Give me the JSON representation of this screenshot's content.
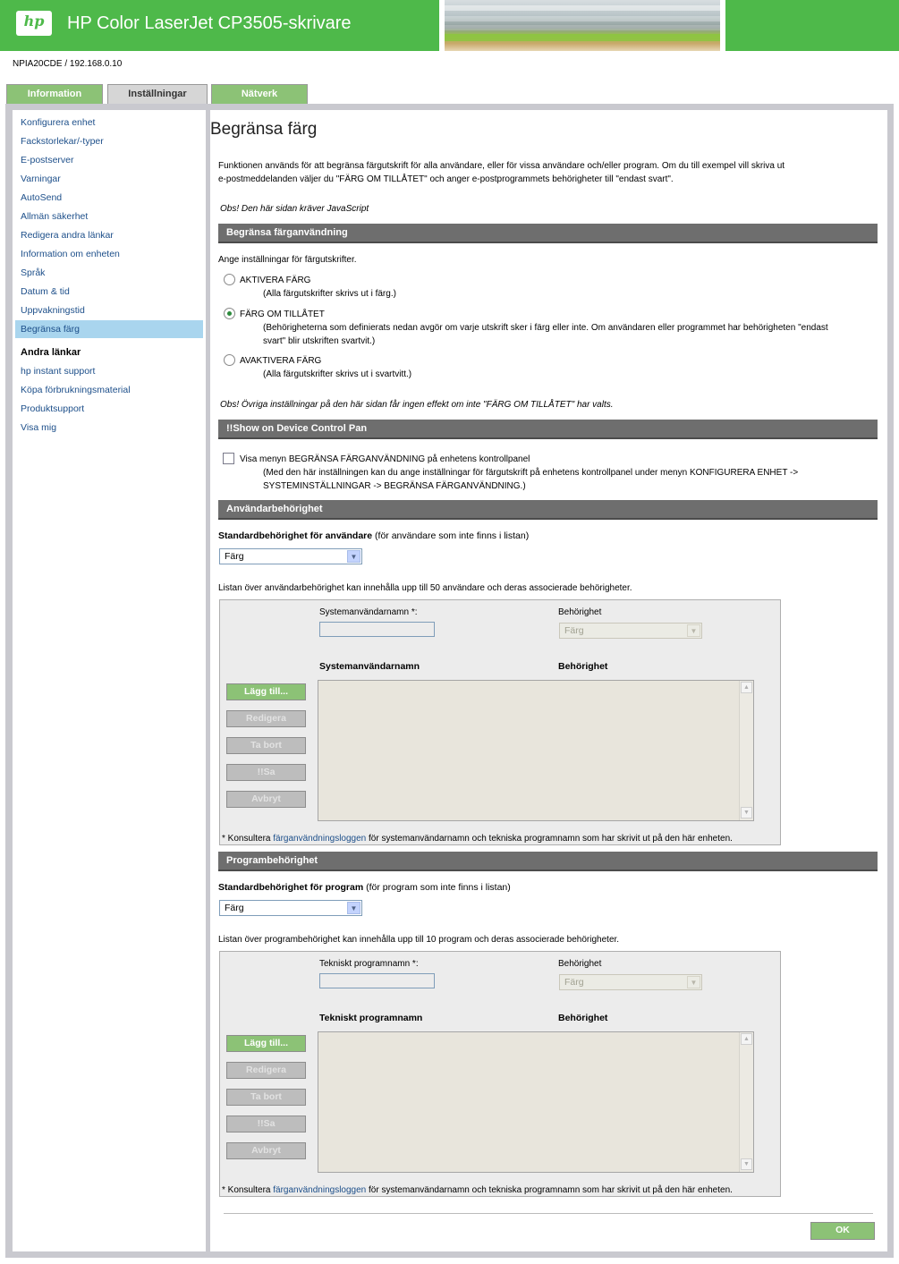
{
  "header": {
    "logo_text": "hp",
    "title": "HP Color LaserJet CP3505-skrivare",
    "device_id": "NPIA20CDE / 192.168.0.10"
  },
  "tabs": [
    {
      "label": "Information",
      "active": false
    },
    {
      "label": "Inställningar",
      "active": true
    },
    {
      "label": "Nätverk",
      "active": false
    }
  ],
  "sidebar": {
    "items": [
      "Konfigurera enhet",
      "Fackstorlekar/-typer",
      "E-postserver",
      "Varningar",
      "AutoSend",
      "Allmän säkerhet",
      "Redigera andra länkar",
      "Information om enheten",
      "Språk",
      "Datum & tid",
      "Uppvakningstid",
      "Begränsa färg"
    ],
    "selected": "Begränsa färg",
    "other_heading": "Andra länkar",
    "other_links": [
      "hp instant support",
      "Köpa förbrukningsmaterial",
      "Produktsupport",
      "Visa mig"
    ]
  },
  "main": {
    "title": "Begränsa färg",
    "intro_line1": "Funktionen används för att begränsa färgutskrift för alla användare, eller för vissa användare och/eller program. Om du till exempel vill skriva ut",
    "intro_line2": "e-postmeddelanden väljer du \"FÄRG OM TILLÅTET\" och anger e-postprogrammets behörigheter till \"endast svart\".",
    "js_note": "Obs! Den här sidan kräver JavaScript",
    "section1": {
      "title": "Begränsa färganvändning",
      "prompt": "Ange inställningar för färgutskrifter.",
      "options": [
        {
          "label": "AKTIVERA FÄRG",
          "desc1": "(Alla färgutskrifter skrivs ut i färg.)",
          "desc2": "",
          "checked": false
        },
        {
          "label": "FÄRG OM TILLÅTET",
          "desc1": "(Behörigheterna som definierats nedan avgör om varje utskrift sker i färg eller inte. Om användaren eller programmet har behörigheten \"endast",
          "desc2": "svart\" blir utskriften svartvit.)",
          "checked": true
        },
        {
          "label": "AVAKTIVERA FÄRG",
          "desc1": "(Alla färgutskrifter skrivs ut i svartvitt.)",
          "desc2": "",
          "checked": false
        }
      ],
      "note": "Obs! Övriga inställningar på den här sidan får ingen effekt om inte \"FÄRG OM TILLÅTET\" har valts."
    },
    "section2": {
      "title": "!!Show on Device Control Pan",
      "checkbox_label": "Visa menyn BEGRÄNSA FÄRGANVÄNDNING på enhetens kontrollpanel",
      "desc1": "(Med den här inställningen kan du ange inställningar för färgutskrift på enhetens kontrollpanel under menyn KONFIGURERA ENHET ->",
      "desc2": "SYSTEMINSTÄLLNINGAR -> BEGRÄNSA FÄRGANVÄNDNING.)",
      "checked": false
    },
    "section3": {
      "title": "Användarbehörighet",
      "default_label_bold": "Standardbehörighet för användare",
      "default_label_rest": " (för användare som inte finns i listan)",
      "default_value": "Färg",
      "list_info": "Listan över användarbehörighet kan innehålla upp till 50 användare och deras associerade behörigheter.",
      "name_field_label": "Systemanvändarnamn *:",
      "perm_field_label": "Behörighet",
      "perm_field_value": "Färg",
      "col_name": "Systemanvändarnamn",
      "col_perm": "Behörighet",
      "buttons": [
        "Lägg till...",
        "Redigera",
        "Ta bort",
        "!!Sa",
        "Avbryt"
      ],
      "footnote_pre": "* Konsultera ",
      "footnote_link": "färganvändningsloggen",
      "footnote_post": " för systemanvändarnamn och tekniska programnamn som har skrivit ut på den här enheten."
    },
    "section4": {
      "title": "Programbehörighet",
      "default_label_bold": "Standardbehörighet för program",
      "default_label_rest": " (för program som inte finns i listan)",
      "default_value": "Färg",
      "list_info": "Listan över programbehörighet kan innehålla upp till 10 program och deras associerade behörigheter.",
      "name_field_label": "Tekniskt programnamn *:",
      "perm_field_label": "Behörighet",
      "perm_field_value": "Färg",
      "col_name": "Tekniskt programnamn",
      "col_perm": "Behörighet",
      "buttons": [
        "Lägg till...",
        "Redigera",
        "Ta bort",
        "!!Sa",
        "Avbryt"
      ],
      "footnote_pre": "* Konsultera ",
      "footnote_link": "färganvändningsloggen",
      "footnote_post": " för systemanvändarnamn och tekniska programnamn som har skrivit ut på den här enheten."
    },
    "ok_label": "OK"
  }
}
